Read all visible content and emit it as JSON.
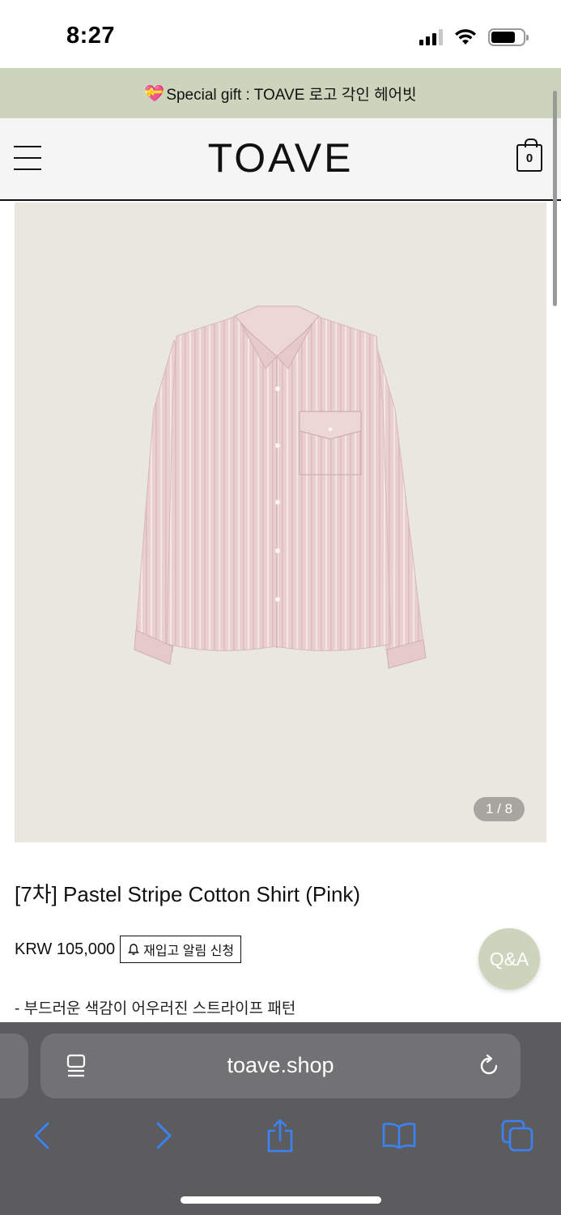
{
  "status_bar": {
    "time": "8:27"
  },
  "promo_banner": {
    "icon": "gift-heart-icon",
    "text": "Special gift : TOAVE 로고 각인 헤어빗"
  },
  "header": {
    "logo": "TOAVE",
    "cart_count": "0"
  },
  "product": {
    "image_alt": "pink striped cotton shirt",
    "image_counter": "1 / 8",
    "title": "[7차] Pastel Stripe Cotton Shirt (Pink)",
    "price": "KRW 105,000",
    "restock_button": "재입고 알림 신청",
    "description": "- 부드러운 색감이 어우러진 스트라이프 패턴"
  },
  "floating": {
    "qa_label": "Q&A"
  },
  "browser": {
    "url": "toave.shop"
  },
  "colors": {
    "banner": "#cdd4bc",
    "accent_blue": "#3b82f6",
    "browser_bar": "#5c5c5e"
  }
}
